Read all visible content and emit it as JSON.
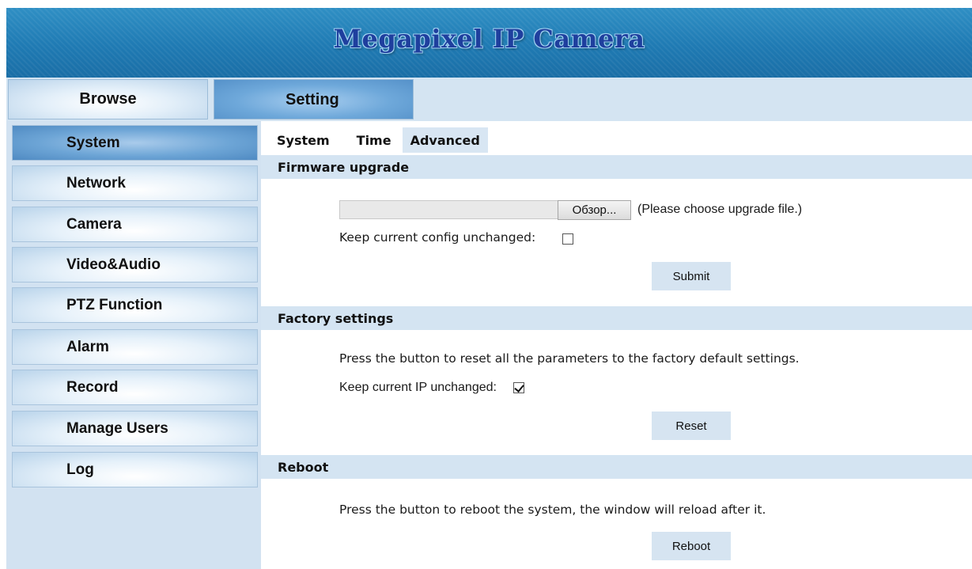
{
  "header": {
    "title": "Megapixel IP Camera"
  },
  "top_tabs": [
    {
      "label": "Browse",
      "active": false
    },
    {
      "label": "Setting",
      "active": true
    }
  ],
  "sidebar": {
    "items": [
      {
        "label": "System",
        "active": true
      },
      {
        "label": "Network",
        "active": false
      },
      {
        "label": "Camera",
        "active": false
      },
      {
        "label": "Video&Audio",
        "active": false
      },
      {
        "label": "PTZ Function",
        "active": false
      },
      {
        "label": "Alarm",
        "active": false
      },
      {
        "label": "Record",
        "active": false
      },
      {
        "label": "Manage Users",
        "active": false
      },
      {
        "label": "Log",
        "active": false
      }
    ]
  },
  "sub_tabs": [
    {
      "label": "System",
      "active": false
    },
    {
      "label": "Time",
      "active": false
    },
    {
      "label": "Advanced",
      "active": true
    }
  ],
  "firmware": {
    "title": "Firmware upgrade",
    "file_value": "",
    "browse_label": "Обзор...",
    "hint": "(Please choose upgrade file.)",
    "keep_config_label": "Keep current config unchanged:",
    "keep_config_checked": false,
    "submit_label": "Submit"
  },
  "factory": {
    "title": "Factory settings",
    "description": "Press the button to reset all the parameters to the factory default settings.",
    "keep_ip_label": "Keep current IP unchanged:",
    "keep_ip_checked": true,
    "reset_label": "Reset"
  },
  "reboot": {
    "title": "Reboot",
    "description": "Press the button to reboot the system, the window will reload after it.",
    "reboot_label": "Reboot"
  },
  "colors": {
    "header_blue": "#1f7ab3",
    "title_blue": "#1f3f9e",
    "panel_light_blue": "#d4e4f2",
    "active_tab_blue": "#6ea8da"
  }
}
